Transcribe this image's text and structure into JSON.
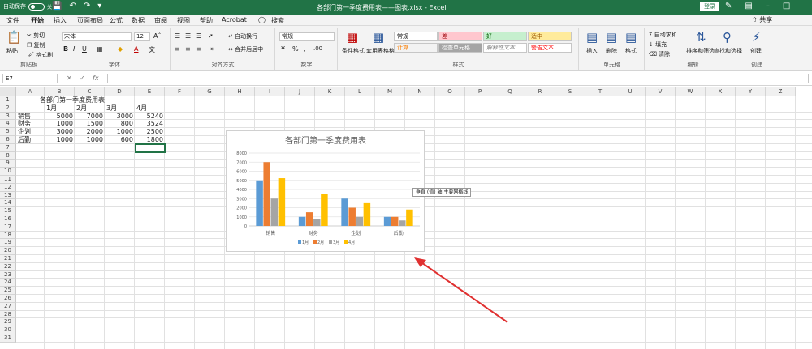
{
  "titlebar": {
    "autosave_label": "自动保存",
    "toggle_state": "关",
    "doc_title": "各部门第一季度费用表——图表.xlsx - Excel",
    "login_label": "登录",
    "brand_color": "#217346"
  },
  "menu": {
    "tabs": [
      "文件",
      "开始",
      "插入",
      "页面布局",
      "公式",
      "数据",
      "审阅",
      "视图",
      "帮助",
      "Acrobat",
      "搜索"
    ],
    "active": "开始",
    "share_label": "共享"
  },
  "ribbon": {
    "clipboard": {
      "paste": "粘贴",
      "cut": "剪切",
      "copy": "复制",
      "format_painter": "格式刷",
      "group": "剪贴板"
    },
    "font": {
      "name": "宋体",
      "size": "12",
      "group": "字体"
    },
    "alignment": {
      "wrap": "自动换行",
      "merge": "合并后居中",
      "group": "对齐方式"
    },
    "number": {
      "format": "常规",
      "group": "数字"
    },
    "styles": {
      "cond_format": "条件格式",
      "table_format": "套用表格格式",
      "cells": [
        {
          "label": "常规",
          "bg": "#ffffff",
          "color": "#000000"
        },
        {
          "label": "差",
          "bg": "#ffc7ce",
          "color": "#9c0006"
        },
        {
          "label": "好",
          "bg": "#c6efce",
          "color": "#006100"
        },
        {
          "label": "适中",
          "bg": "#ffeb9c",
          "color": "#9c5700"
        },
        {
          "label": "计算",
          "bg": "#f2f2f2",
          "color": "#fa7d00"
        },
        {
          "label": "检查单元格",
          "bg": "#a5a5a5",
          "color": "#ffffff"
        },
        {
          "label": "解释性文本",
          "bg": "#ffffff",
          "color": "#7f7f7f"
        },
        {
          "label": "警告文本",
          "bg": "#ffffff",
          "color": "#ff0000"
        }
      ],
      "group": "样式"
    },
    "cells_group": {
      "insert": "插入",
      "delete": "删除",
      "format": "格式",
      "group": "单元格"
    },
    "editing": {
      "autosum": "自动求和",
      "fill": "填充",
      "clear": "清除",
      "sort": "排序和筛选",
      "find": "查找和选择",
      "group": "编辑"
    },
    "create": {
      "label": "创建",
      "group": "创建"
    }
  },
  "formula": {
    "namebox": "E7",
    "fx": "fx",
    "content": ""
  },
  "sheet": {
    "columns": [
      "A",
      "B",
      "C",
      "D",
      "E",
      "F",
      "G",
      "H",
      "I",
      "J",
      "K",
      "L",
      "M",
      "N",
      "O",
      "P",
      "Q",
      "R",
      "S",
      "T",
      "U",
      "V",
      "W",
      "X",
      "Y",
      "Z"
    ],
    "rows": [
      "1",
      "2",
      "3",
      "4",
      "5",
      "6",
      "7",
      "8",
      "9",
      "10",
      "11",
      "12",
      "13",
      "14",
      "15",
      "16",
      "17",
      "18",
      "19",
      "20",
      "21",
      "22",
      "23",
      "24",
      "25",
      "26",
      "27",
      "28",
      "29",
      "30",
      "31"
    ],
    "table_title": "各部门第一季度费用表",
    "months": [
      "1月",
      "2月",
      "3月",
      "4月"
    ],
    "data_rows": [
      {
        "dept": "销售",
        "values": [
          "5000",
          "7000",
          "3000",
          "5240"
        ]
      },
      {
        "dept": "财务",
        "values": [
          "1000",
          "1500",
          "800",
          "3524"
        ]
      },
      {
        "dept": "企划",
        "values": [
          "3000",
          "2000",
          "1000",
          "2500"
        ]
      },
      {
        "dept": "后勤",
        "values": [
          "1000",
          "1000",
          "600",
          "1800"
        ]
      }
    ]
  },
  "chart_data": {
    "type": "bar",
    "title": "各部门第一季度费用表",
    "categories": [
      "销售",
      "财务",
      "企划",
      "后勤"
    ],
    "series": [
      {
        "name": "1月",
        "color": "#5b9bd5",
        "values": [
          5000,
          1000,
          3000,
          1000
        ]
      },
      {
        "name": "2月",
        "color": "#ed7d31",
        "values": [
          7000,
          1500,
          2000,
          1000
        ]
      },
      {
        "name": "3月",
        "color": "#a5a5a5",
        "values": [
          3000,
          800,
          1000,
          600
        ]
      },
      {
        "name": "4月",
        "color": "#ffc000",
        "values": [
          5240,
          3524,
          2500,
          1800
        ]
      }
    ],
    "ylim": [
      0,
      8000
    ],
    "yticks": [
      "0",
      "1000",
      "2000",
      "3000",
      "4000",
      "5000",
      "6000",
      "7000",
      "8000"
    ],
    "grid": true,
    "legend": "bottom"
  },
  "tooltip": "垂直 (值) 轴 主要网格线",
  "annotation_arrow_color": "#e03030"
}
